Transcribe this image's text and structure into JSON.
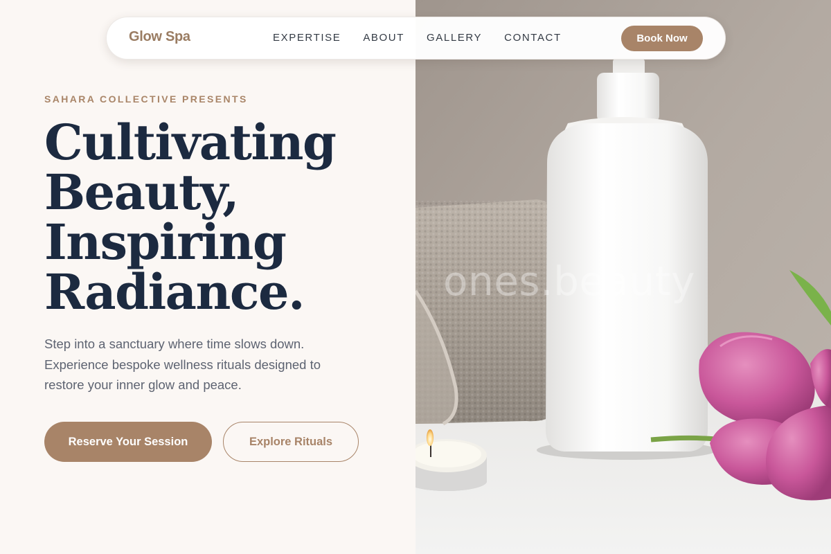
{
  "nav": {
    "brand": "Glow Spa",
    "links": [
      "EXPERTISE",
      "ABOUT",
      "GALLERY",
      "CONTACT"
    ],
    "cta": "Book Now"
  },
  "hero": {
    "eyebrow": "SAHARA COLLECTIVE PRESENTS",
    "headline_lines": [
      "Cultivating",
      "Beauty,",
      "Inspiring",
      "Radiance."
    ],
    "lead_lines": [
      "Step into a sanctuary where time slows down.",
      "Experience bespoke wellness rituals designed to",
      "restore your inner glow and peace."
    ],
    "primary_button": "Reserve Your Session",
    "secondary_button": "Explore Rituals"
  },
  "photo": {
    "watermark": "ones.beauty",
    "subjects": [
      "pump-bottle",
      "rolled-towel",
      "tealight-candle",
      "pink-tulips"
    ]
  },
  "colors": {
    "accent": "#a88468",
    "heading": "#1c2a40",
    "background": "#fbf7f4",
    "body_text": "#5d6371"
  }
}
